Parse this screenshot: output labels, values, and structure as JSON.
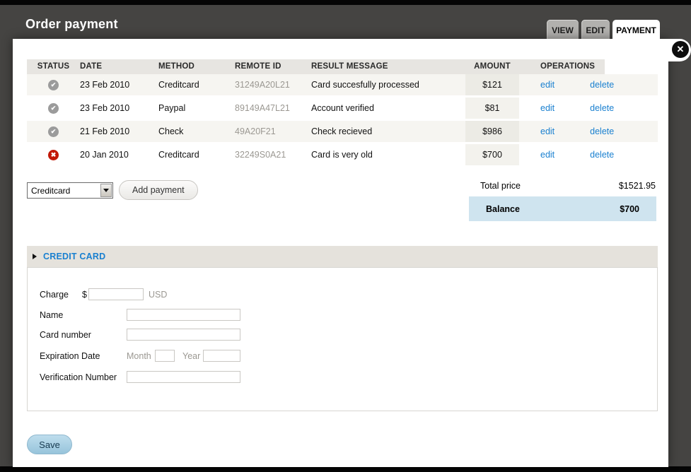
{
  "title_bar": {
    "title": "Order payment"
  },
  "tabs": [
    {
      "label": "VIEW",
      "active": false
    },
    {
      "label": "EDIT",
      "active": false
    },
    {
      "label": "PAYMENT",
      "active": true
    }
  ],
  "payments_table": {
    "columns": [
      "STATUS",
      "DATE",
      "METHOD",
      "REMOTE ID",
      "RESULT MESSAGE",
      "AMOUNT",
      "OPERATIONS"
    ],
    "rows": [
      {
        "status": "success",
        "date": "23 Feb 2010",
        "method": "Creditcard",
        "remote_id": "31249A20L21",
        "result_message": "Card succesfully processed",
        "amount": "$121"
      },
      {
        "status": "success",
        "date": "23 Feb 2010",
        "method": "Paypal",
        "remote_id": "89149A47L21",
        "result_message": "Account verified",
        "amount": "$81"
      },
      {
        "status": "success",
        "date": "21 Feb 2010",
        "method": "Check",
        "remote_id": "49A20F21",
        "result_message": "Check recieved",
        "amount": "$986"
      },
      {
        "status": "failed",
        "date": "20 Jan 2010",
        "method": "Creditcard",
        "remote_id": "32249S0A21",
        "result_message": "Card is very old",
        "amount": "$700"
      }
    ],
    "edit_label": "edit",
    "delete_label": "delete"
  },
  "add_payment": {
    "method_selector_value": "Creditcard",
    "button_label": "Add payment"
  },
  "totals": {
    "total_label": "Total price",
    "total_value": "$1521.95",
    "balance_label": "Balance",
    "balance_value": "$700"
  },
  "credit_card": {
    "section_title": "CREDIT CARD",
    "charge_label": "Charge",
    "currency_prefix": "$",
    "currency_suffix": "USD",
    "name_label": "Name",
    "card_number_label": "Card number",
    "expiration_label": "Expiration Date",
    "month_label": "Month",
    "year_label": "Year",
    "verification_label": "Verification Number"
  },
  "actions": {
    "save_label": "Save"
  },
  "colors": {
    "accent_blue": "#1a80d0",
    "balance_bg": "#cfe4ef",
    "status_ok": "#9b9b9b",
    "status_error": "#c21807",
    "overlay_bg": "#454442"
  }
}
